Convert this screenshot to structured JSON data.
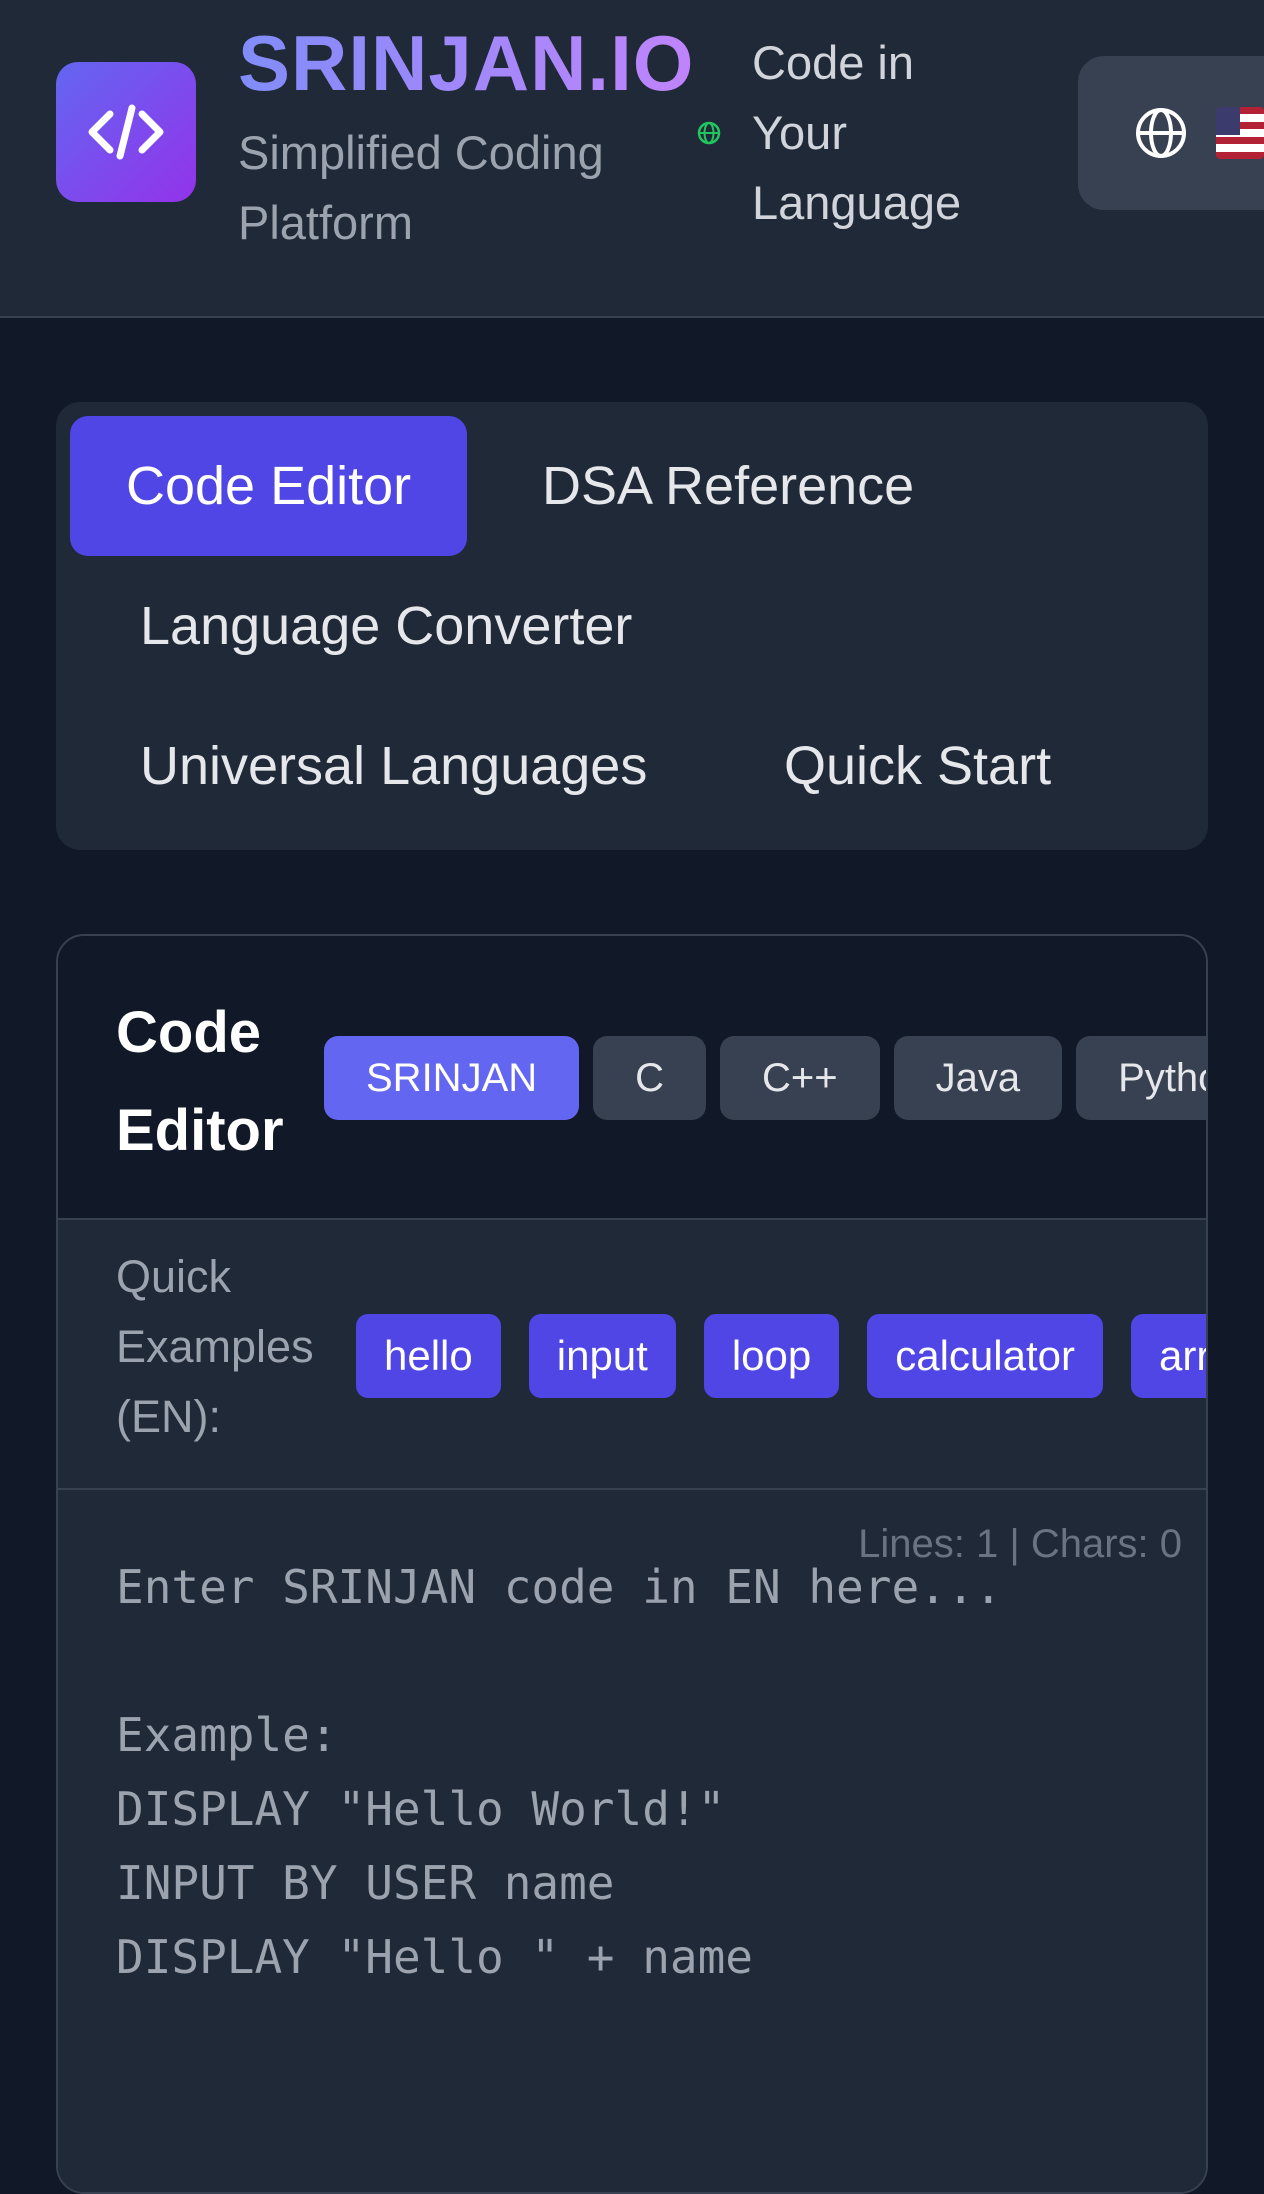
{
  "header": {
    "brand_title": "SRINJAN.IO",
    "brand_subtitle": "Simplified Coding Platform",
    "tagline": "Code in Your Language",
    "logo_icon": "code-brackets-icon",
    "language_switch": {
      "icon": "globe-icon",
      "flag": "us-flag-icon"
    },
    "colors": {
      "brand_gradient_start": "#818cf8",
      "brand_gradient_end": "#c084fc",
      "status_dot": "#22c55e"
    }
  },
  "nav": {
    "tabs": [
      {
        "label": "Code Editor",
        "active": true
      },
      {
        "label": "DSA Reference",
        "active": false
      },
      {
        "label": "Language Converter",
        "active": false
      },
      {
        "label": "Universal Languages",
        "active": false
      },
      {
        "label": "Quick Start",
        "active": false
      }
    ]
  },
  "editor": {
    "title": "Code Editor",
    "languages": [
      {
        "label": "SRINJAN",
        "active": true
      },
      {
        "label": "C",
        "active": false
      },
      {
        "label": "C++",
        "active": false
      },
      {
        "label": "Java",
        "active": false
      },
      {
        "label": "Python",
        "active": false
      }
    ],
    "examples_label": "Quick Examples (EN):",
    "examples": [
      "hello",
      "input",
      "loop",
      "calculator",
      "array"
    ],
    "counter": "Lines: 1 | Chars: 0",
    "placeholder": "Enter SRINJAN code in EN here...\n\nExample:\nDISPLAY \"Hello World!\"\nINPUT BY USER name\nDISPLAY \"Hello \" + name"
  },
  "colors": {
    "page_bg": "#111827",
    "panel_bg": "#1f2937",
    "accent": "#4f46e5",
    "accent_light": "#6366f1"
  }
}
